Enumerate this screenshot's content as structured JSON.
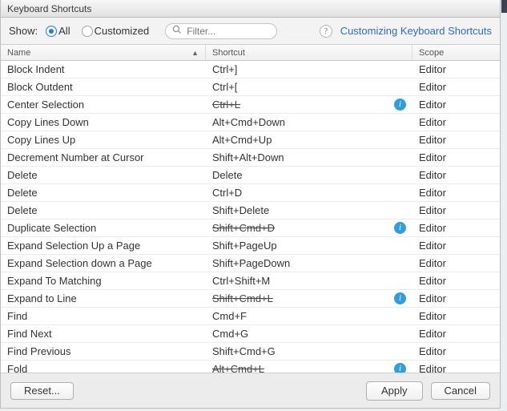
{
  "title": "Keyboard Shortcuts",
  "toolbar": {
    "show_label": "Show:",
    "radio_all": "All",
    "radio_customized": "Customized",
    "filter_placeholder": "Filter..."
  },
  "help": {
    "link_text": "Customizing Keyboard Shortcuts"
  },
  "columns": {
    "name": "Name",
    "shortcut": "Shortcut",
    "scope": "Scope"
  },
  "rows": [
    {
      "name": "Block Indent",
      "shortcut": "Ctrl+]",
      "scope": "Editor",
      "strike": false,
      "info": false
    },
    {
      "name": "Block Outdent",
      "shortcut": "Ctrl+[",
      "scope": "Editor",
      "strike": false,
      "info": false
    },
    {
      "name": "Center Selection",
      "shortcut": "Ctrl+L",
      "scope": "Editor",
      "strike": true,
      "info": true
    },
    {
      "name": "Copy Lines Down",
      "shortcut": "Alt+Cmd+Down",
      "scope": "Editor",
      "strike": false,
      "info": false
    },
    {
      "name": "Copy Lines Up",
      "shortcut": "Alt+Cmd+Up",
      "scope": "Editor",
      "strike": false,
      "info": false
    },
    {
      "name": "Decrement Number at Cursor",
      "shortcut": "Shift+Alt+Down",
      "scope": "Editor",
      "strike": false,
      "info": false
    },
    {
      "name": "Delete",
      "shortcut": "Delete",
      "scope": "Editor",
      "strike": false,
      "info": false
    },
    {
      "name": "Delete",
      "shortcut": "Ctrl+D",
      "scope": "Editor",
      "strike": false,
      "info": false
    },
    {
      "name": "Delete",
      "shortcut": "Shift+Delete",
      "scope": "Editor",
      "strike": false,
      "info": false
    },
    {
      "name": "Duplicate Selection",
      "shortcut": "Shift+Cmd+D",
      "scope": "Editor",
      "strike": true,
      "info": true
    },
    {
      "name": "Expand Selection Up a Page",
      "shortcut": "Shift+PageUp",
      "scope": "Editor",
      "strike": false,
      "info": false
    },
    {
      "name": "Expand Selection down a Page",
      "shortcut": "Shift+PageDown",
      "scope": "Editor",
      "strike": false,
      "info": false
    },
    {
      "name": "Expand To Matching",
      "shortcut": "Ctrl+Shift+M",
      "scope": "Editor",
      "strike": false,
      "info": false
    },
    {
      "name": "Expand to Line",
      "shortcut": "Shift+Cmd+L",
      "scope": "Editor",
      "strike": true,
      "info": true
    },
    {
      "name": "Find",
      "shortcut": "Cmd+F",
      "scope": "Editor",
      "strike": false,
      "info": false
    },
    {
      "name": "Find Next",
      "shortcut": "Cmd+G",
      "scope": "Editor",
      "strike": false,
      "info": false
    },
    {
      "name": "Find Previous",
      "shortcut": "Shift+Cmd+G",
      "scope": "Editor",
      "strike": false,
      "info": false
    },
    {
      "name": "Fold",
      "shortcut": "Alt+Cmd+L",
      "scope": "Editor",
      "strike": true,
      "info": true
    }
  ],
  "footer": {
    "reset_label": "Reset...",
    "apply_label": "Apply",
    "cancel_label": "Cancel"
  }
}
